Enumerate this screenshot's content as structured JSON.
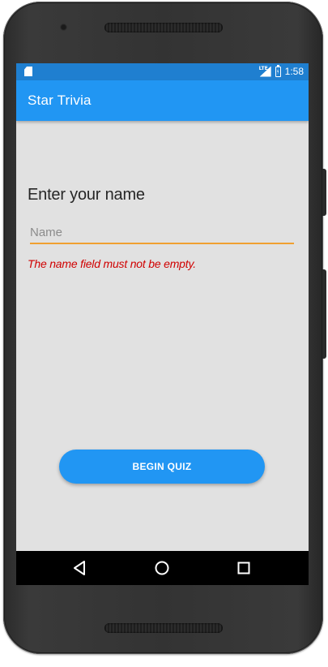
{
  "status_bar": {
    "time": "1:58",
    "network_label": "LTE"
  },
  "app_bar": {
    "title": "Star Trivia",
    "color": "#2196f3"
  },
  "main": {
    "heading": "Enter your name",
    "name_input": {
      "placeholder": "Name",
      "value": ""
    },
    "error_message": "The name field must not be empty.",
    "error_color": "#d00000",
    "begin_button_label": "BEGIN QUIZ"
  },
  "nav_bar": {
    "items": [
      "back-icon",
      "home-icon",
      "recents-icon"
    ]
  }
}
